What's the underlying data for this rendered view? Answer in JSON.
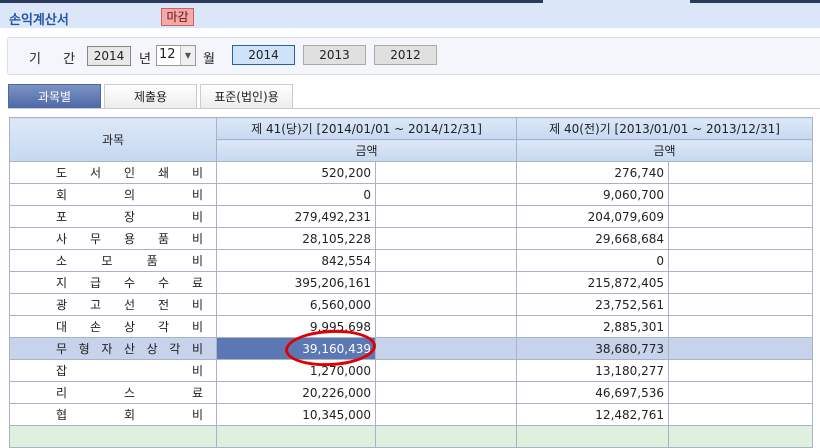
{
  "header": {
    "title": "손익계산서",
    "status_badge": "마감"
  },
  "filter": {
    "period_label": "기 간",
    "year": "2014",
    "year_unit": "년",
    "month": "12",
    "month_unit": "월",
    "year_buttons": [
      "2014",
      "2013",
      "2012"
    ],
    "active_year": "2014"
  },
  "tabs": [
    {
      "label": "과목별",
      "active": true
    },
    {
      "label": "제출용"
    },
    {
      "label": "표준(법인)용"
    }
  ],
  "table": {
    "subject_header": "과목",
    "current_period": "제 41(당)기 [2014/01/01 ~ 2014/12/31]",
    "prior_period": "제 40(전)기 [2013/01/01 ~ 2013/12/31]",
    "amount_header": "금액",
    "rows": [
      {
        "name": "도 서 인 쇄 비",
        "current": "520,200",
        "prior": "276,740"
      },
      {
        "name": "회 의 비",
        "current": "0",
        "prior": "9,060,700"
      },
      {
        "name": "포 장 비",
        "current": "279,492,231",
        "prior": "204,079,609"
      },
      {
        "name": "사 무 용 품 비",
        "current": "28,105,228",
        "prior": "29,668,684"
      },
      {
        "name": "소 모 품 비",
        "current": "842,554",
        "prior": "0"
      },
      {
        "name": "지 급 수 수 료",
        "current": "395,206,161",
        "prior": "215,872,405"
      },
      {
        "name": "광 고 선 전 비",
        "current": "6,560,000",
        "prior": "23,752,561"
      },
      {
        "name": "대 손 상 각 비",
        "current": "9,995,698",
        "prior": "2,885,301"
      },
      {
        "name": "무 형 자 산 상 각 비",
        "current": "39,160,439",
        "prior": "38,680,773",
        "selected": true
      },
      {
        "name": "잡 비",
        "current": "1,270,000",
        "prior": "13,180,277"
      },
      {
        "name": "리 스 료",
        "current": "20,226,000",
        "prior": "46,697,536"
      },
      {
        "name": "협 회 비",
        "current": "10,345,000",
        "prior": "12,482,761"
      }
    ]
  },
  "colors": {
    "accent": "#2456a8",
    "selected_cell": "#5b78b4",
    "selected_row": "#c7d3ea",
    "annotation": "#e00000"
  }
}
